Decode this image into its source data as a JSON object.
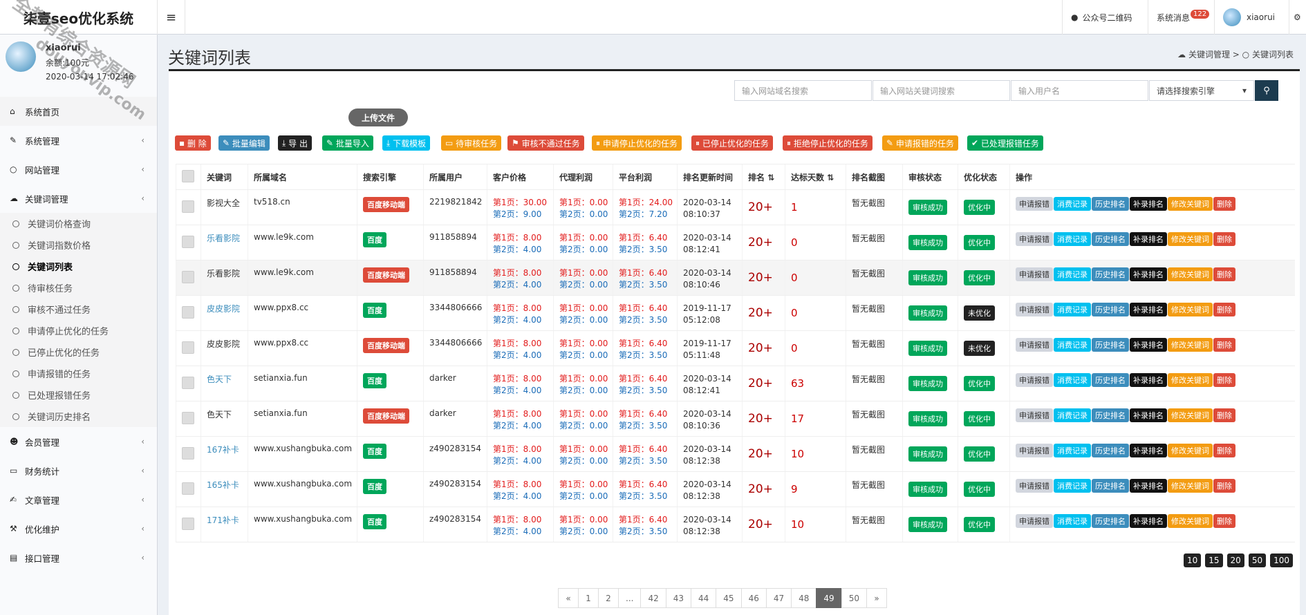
{
  "top": {
    "logo": "柒壹seo优化系统",
    "menu_toggle": "≡",
    "qr": "公众号二维码",
    "messages": "系统消息",
    "messages_count": "122",
    "username": "xiaorui"
  },
  "user_panel": {
    "name": "xiaorui",
    "balance": "余额:100元",
    "time": "2020-03-14 17:02:46"
  },
  "nav": {
    "home": "系统首页",
    "system": "系统管理",
    "site": "网站管理",
    "keyword": "关键词管理",
    "keyword_sub": [
      "关键词价格查询",
      "关键词指数价格",
      "关键词列表",
      "待审核任务",
      "审核不通过任务",
      "申请停止优化的任务",
      "已停止优化的任务",
      "申请报错的任务",
      "已处理报错任务",
      "关键词历史排名"
    ],
    "member": "会员管理",
    "finance": "财务统计",
    "article": "文章管理",
    "optimize": "优化维护",
    "api": "接口管理"
  },
  "page": {
    "title": "关键词列表",
    "breadcrumb_parent": "关键词管理",
    "breadcrumb_sep": ">",
    "breadcrumb_current": "关键词列表"
  },
  "search": {
    "domain_ph": "输入网站域名搜索",
    "keyword_ph": "输入网站关键词搜索",
    "user_ph": "输入用户名",
    "engine_ph": "请选择搜索引擎"
  },
  "toolbar": {
    "upload": "上传文件",
    "delete": "删 除",
    "batch_edit": "批量编辑",
    "export": "导 出",
    "batch_import": "批量导入",
    "download_tpl": "下载模板",
    "pending": "待审核任务",
    "rejected": "审核不通过任务",
    "req_stop": "申请停止优化的任务",
    "stopped": "已停止优化的任务",
    "refuse_stop": "拒绝停止优化的任务",
    "req_error": "申请报错的任务",
    "handled_error": "已处理报错任务"
  },
  "table": {
    "headers": [
      "关键词",
      "所属域名",
      "搜索引擎",
      "所属用户",
      "客户价格",
      "代理利润",
      "平台利润",
      "排名更新时间",
      "排名",
      "达标天数",
      "排名截图",
      "审核状态",
      "优化状态",
      "操作"
    ],
    "sort_icon": "⇅",
    "actions": [
      "申请报错",
      "消费记录",
      "历史排名",
      "补录排名",
      "修改关键词",
      "删除"
    ],
    "screenshot_text": "暂无截图",
    "rows": [
      {
        "kw": "影视大全",
        "link": false,
        "domain": "tv518.cn",
        "engine": "百度移动端",
        "mob": true,
        "user": "2219821842",
        "c1": "第1页：30.00",
        "c2": "第2页：9.00",
        "a1": "第1页：0.00",
        "a2": "第2页：0.00",
        "p1": "第1页：24.00",
        "p2": "第2页：7.20",
        "date": "2020-03-14",
        "time": "08:10:37",
        "rank": "20+",
        "days": "1",
        "audit": "审核成功",
        "opt": "优化中",
        "opt_on": true
      },
      {
        "kw": "乐看影院",
        "link": true,
        "domain": "www.le9k.com",
        "engine": "百度",
        "mob": false,
        "user": "911858894",
        "c1": "第1页：8.00",
        "c2": "第2页：4.00",
        "a1": "第1页：0.00",
        "a2": "第2页：0.00",
        "p1": "第1页：6.40",
        "p2": "第2页：3.50",
        "date": "2020-03-14",
        "time": "08:12:41",
        "rank": "20+",
        "days": "0",
        "audit": "审核成功",
        "opt": "优化中",
        "opt_on": true
      },
      {
        "kw": "乐看影院",
        "link": false,
        "domain": "www.le9k.com",
        "engine": "百度移动端",
        "mob": true,
        "user": "911858894",
        "c1": "第1页：8.00",
        "c2": "第2页：4.00",
        "a1": "第1页：0.00",
        "a2": "第2页：0.00",
        "p1": "第1页：6.40",
        "p2": "第2页：3.50",
        "date": "2020-03-14",
        "time": "08:10:46",
        "rank": "20+",
        "days": "0",
        "audit": "审核成功",
        "opt": "优化中",
        "opt_on": true
      },
      {
        "kw": "皮皮影院",
        "link": true,
        "domain": "www.ppx8.cc",
        "engine": "百度",
        "mob": false,
        "user": "3344806666",
        "c1": "第1页：8.00",
        "c2": "第2页：4.00",
        "a1": "第1页：0.00",
        "a2": "第2页：0.00",
        "p1": "第1页：6.40",
        "p2": "第2页：3.50",
        "date": "2019-11-17",
        "time": "05:12:08",
        "rank": "20+",
        "days": "0",
        "audit": "审核成功",
        "opt": "未优化",
        "opt_on": false
      },
      {
        "kw": "皮皮影院",
        "link": false,
        "domain": "www.ppx8.cc",
        "engine": "百度移动端",
        "mob": true,
        "user": "3344806666",
        "c1": "第1页：8.00",
        "c2": "第2页：4.00",
        "a1": "第1页：0.00",
        "a2": "第2页：0.00",
        "p1": "第1页：6.40",
        "p2": "第2页：3.50",
        "date": "2019-11-17",
        "time": "05:11:48",
        "rank": "20+",
        "days": "0",
        "audit": "审核成功",
        "opt": "未优化",
        "opt_on": false
      },
      {
        "kw": "色天下",
        "link": true,
        "domain": "setianxia.fun",
        "engine": "百度",
        "mob": false,
        "user": "darker",
        "c1": "第1页：8.00",
        "c2": "第2页：4.00",
        "a1": "第1页：0.00",
        "a2": "第2页：0.00",
        "p1": "第1页：6.40",
        "p2": "第2页：3.50",
        "date": "2020-03-14",
        "time": "08:12:41",
        "rank": "20+",
        "days": "63",
        "audit": "审核成功",
        "opt": "优化中",
        "opt_on": true
      },
      {
        "kw": "色天下",
        "link": false,
        "domain": "setianxia.fun",
        "engine": "百度移动端",
        "mob": true,
        "user": "darker",
        "c1": "第1页：8.00",
        "c2": "第2页：4.00",
        "a1": "第1页：0.00",
        "a2": "第2页：0.00",
        "p1": "第1页：6.40",
        "p2": "第2页：3.50",
        "date": "2020-03-14",
        "time": "08:10:36",
        "rank": "20+",
        "days": "17",
        "audit": "审核成功",
        "opt": "优化中",
        "opt_on": true
      },
      {
        "kw": "167补卡",
        "link": true,
        "domain": "www.xushangbuka.com",
        "engine": "百度",
        "mob": false,
        "user": "z490283154",
        "c1": "第1页：8.00",
        "c2": "第2页：4.00",
        "a1": "第1页：0.00",
        "a2": "第2页：0.00",
        "p1": "第1页：6.40",
        "p2": "第2页：3.50",
        "date": "2020-03-14",
        "time": "08:12:38",
        "rank": "20+",
        "days": "10",
        "audit": "审核成功",
        "opt": "优化中",
        "opt_on": true
      },
      {
        "kw": "165补卡",
        "link": true,
        "domain": "www.xushangbuka.com",
        "engine": "百度",
        "mob": false,
        "user": "z490283154",
        "c1": "第1页：8.00",
        "c2": "第2页：4.00",
        "a1": "第1页：0.00",
        "a2": "第2页：0.00",
        "p1": "第1页：6.40",
        "p2": "第2页：3.50",
        "date": "2020-03-14",
        "time": "08:12:38",
        "rank": "20+",
        "days": "9",
        "audit": "审核成功",
        "opt": "优化中",
        "opt_on": true
      },
      {
        "kw": "171补卡",
        "link": true,
        "domain": "www.xushangbuka.com",
        "engine": "百度",
        "mob": false,
        "user": "z490283154",
        "c1": "第1页：8.00",
        "c2": "第2页：4.00",
        "a1": "第1页：0.00",
        "a2": "第2页：0.00",
        "p1": "第1页：6.40",
        "p2": "第2页：3.50",
        "date": "2020-03-14",
        "time": "08:12:38",
        "rank": "20+",
        "days": "10",
        "audit": "审核成功",
        "opt": "优化中",
        "opt_on": true
      }
    ]
  },
  "page_sizes": [
    "10",
    "15",
    "20",
    "50",
    "100"
  ],
  "pagination": {
    "pages": [
      "«",
      "1",
      "2",
      "...",
      "42",
      "43",
      "44",
      "45",
      "46",
      "47",
      "48",
      "49",
      "50",
      "»"
    ],
    "current": "49"
  },
  "watermark": [
    "全都有综合资源网",
    "douyouvip.com"
  ]
}
